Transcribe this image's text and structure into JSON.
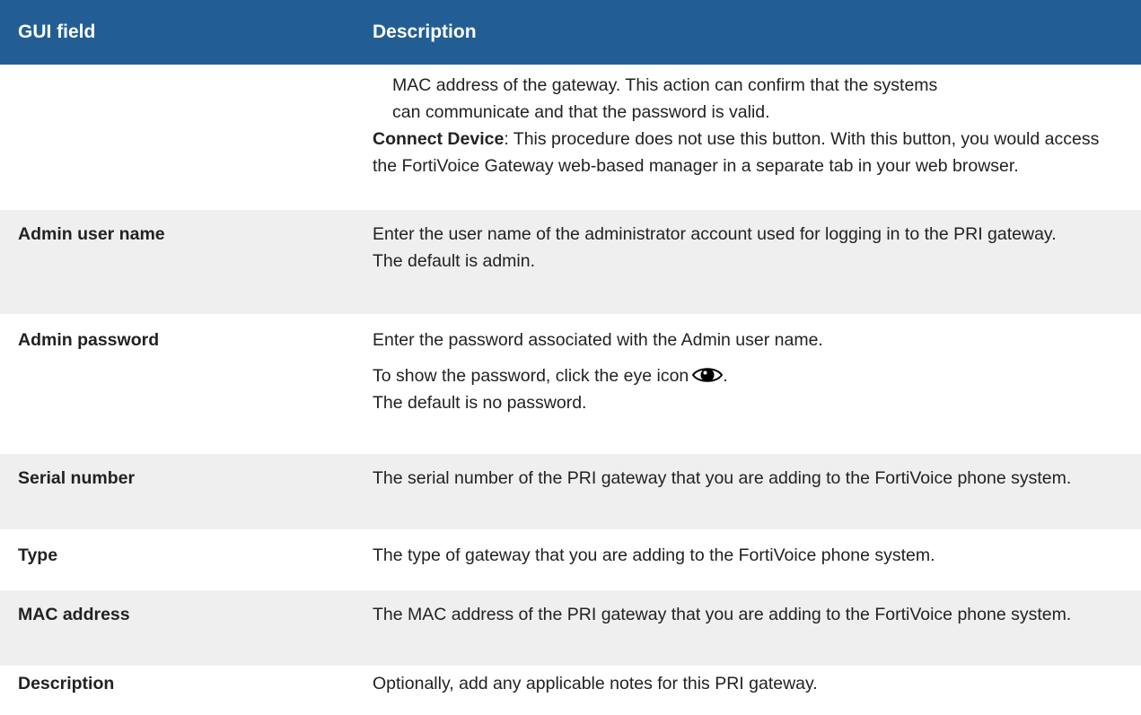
{
  "header": {
    "col1": "GUI field",
    "col2": "Description"
  },
  "rows": {
    "continuation": {
      "field": "",
      "line1": "MAC address of the gateway. This action can confirm that the systems",
      "line2": "can communicate and that the password is valid.",
      "connect_label": "Connect Device",
      "connect_text": ": This procedure does not use this button. With this button, you would access the FortiVoice Gateway web-based manager in a separate tab in your web browser."
    },
    "admin_user": {
      "field": "Admin user name",
      "p1": "Enter the user name of the administrator account used for logging in to the PRI gateway.",
      "p2": "The default is admin."
    },
    "admin_password": {
      "field": "Admin password",
      "p1": "Enter the password associated with the Admin user name.",
      "p2": "To show the password, click the eye icon",
      "p2_end": ".",
      "p3": "The default is no password."
    },
    "serial": {
      "field": "Serial number",
      "p1": "The serial number of the PRI gateway that you are adding to the FortiVoice phone system."
    },
    "type": {
      "field": "Type",
      "p1": "The type of gateway that you are adding to the FortiVoice phone system."
    },
    "mac": {
      "field": "MAC address",
      "p1": "The MAC address of the PRI gateway that you are adding to the FortiVoice phone system."
    },
    "description": {
      "field": "Description",
      "p1": "Optionally, add any applicable notes for this PRI gateway."
    }
  },
  "colors": {
    "header_bg": "#225e94",
    "row_grey": "#efefef",
    "row_white": "#ffffff"
  },
  "icons": {
    "eye": "eye-icon"
  }
}
